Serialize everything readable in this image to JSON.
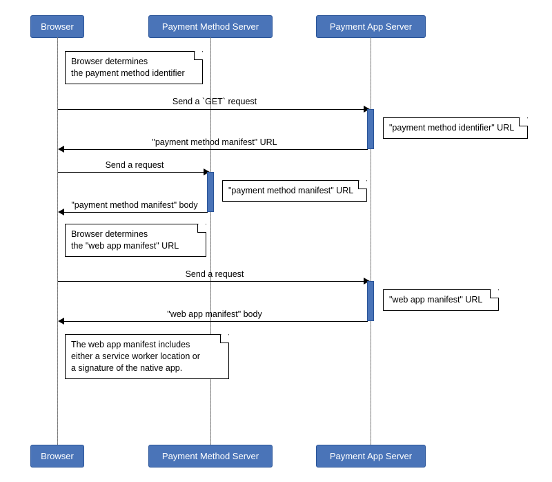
{
  "participants": {
    "browser": "Browser",
    "payment_method_server": "Payment Method Server",
    "payment_app_server": "Payment App Server"
  },
  "notes": {
    "n1": "Browser determines\nthe payment method identifier",
    "n2": "\"payment method identifier\" URL",
    "n3": "\"payment method manifest\" URL",
    "n4": "Browser determines\nthe \"web app manifest\" URL",
    "n5": "\"web app manifest\" URL",
    "n6": "The web app manifest includes\neither a service worker location or\na signature of the native app."
  },
  "messages": {
    "m1": "Send a `GET` request",
    "m2": "\"payment method manifest\" URL",
    "m3": "Send a request",
    "m4": "\"payment method manifest\" body",
    "m5": "Send a request",
    "m6": "\"web app manifest\" body"
  }
}
